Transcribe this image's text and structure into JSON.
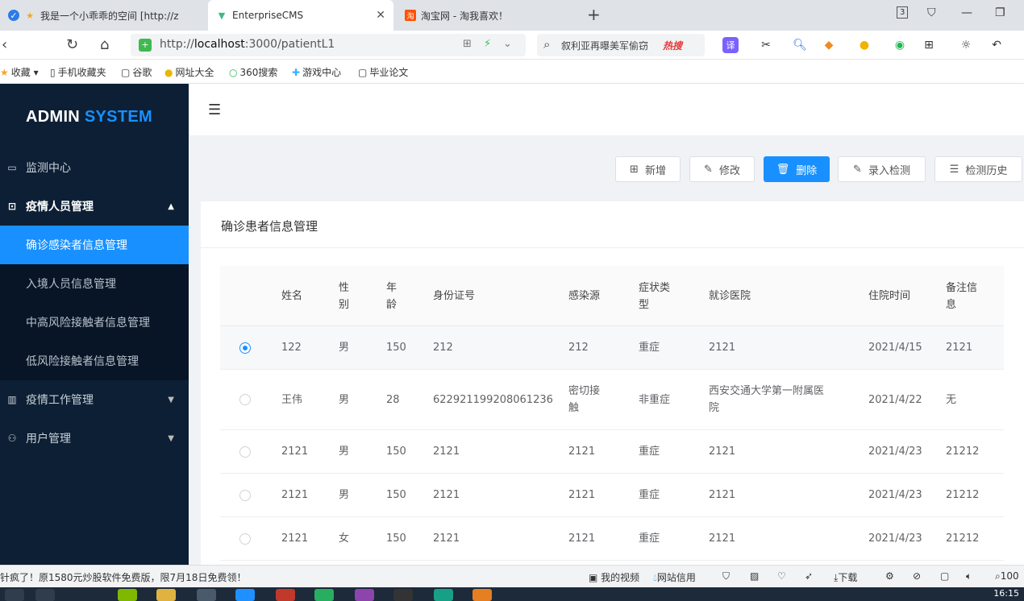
{
  "browser": {
    "tabs": [
      {
        "label": "我是一个小乖乖的空间 [http://z",
        "icon": "star-icon"
      },
      {
        "label": "EnterpriseCMS",
        "icon": "vue-logo-icon"
      },
      {
        "label": "淘宝网 - 淘我喜欢！",
        "icon": "taobao-icon"
      }
    ],
    "tab_count": "3",
    "url": {
      "prefix": "http://",
      "host": "localhost",
      "rest": ":3000/patientL1"
    },
    "search": {
      "text": "叙利亚再曝美军偷窃",
      "badge": "热搜"
    },
    "bookmarks": [
      "收藏",
      "手机收藏夹",
      "谷歌",
      "网址大全",
      "360搜索",
      "游戏中心",
      "毕业论文"
    ]
  },
  "app": {
    "logo": {
      "part1": "ADMIN ",
      "part2": "SYSTEM"
    },
    "menu": {
      "monitor": "监测中心",
      "epidemic_people": "疫情人员管理",
      "sub_confirmed": "确诊感染者信息管理",
      "sub_entry": "入境人员信息管理",
      "sub_high_risk": "中高风险接触者信息管理",
      "sub_low_risk": "低风险接触者信息管理",
      "epidemic_work": "疫情工作管理",
      "user_mgmt": "用户管理"
    },
    "toolbar": {
      "add": "新增",
      "edit": "修改",
      "delete": "删除",
      "record": "录入检测",
      "history": "检测历史"
    },
    "panel_title": "确诊患者信息管理",
    "table": {
      "headers": {
        "name": "姓名",
        "gender_1": "性",
        "gender_2": "别",
        "age_1": "年",
        "age_2": "龄",
        "id": "身份证号",
        "source": "感染源",
        "symptom_1": "症状类",
        "symptom_2": "型",
        "hospital": "就诊医院",
        "admit": "住院时间",
        "note_1": "备注信",
        "note_2": "息"
      },
      "rows": [
        {
          "name": "122",
          "gender": "男",
          "age": "150",
          "id": "212",
          "source": "212",
          "source2": "",
          "symptom": "重症",
          "hospital": "2121",
          "hospital2": "",
          "admit": "2021/4/15",
          "note": "2121"
        },
        {
          "name": "王伟",
          "gender": "男",
          "age": "28",
          "id": "622921199208061236",
          "source": "密切接",
          "source2": "触",
          "symptom": "非重症",
          "hospital": "西安交通大学第一附属医",
          "hospital2": "院",
          "admit": "2021/4/22",
          "note": "无"
        },
        {
          "name": "2121",
          "gender": "男",
          "age": "150",
          "id": "2121",
          "source": "2121",
          "source2": "",
          "symptom": "重症",
          "hospital": "2121",
          "hospital2": "",
          "admit": "2021/4/23",
          "note": "21212"
        },
        {
          "name": "2121",
          "gender": "男",
          "age": "150",
          "id": "2121",
          "source": "2121",
          "source2": "",
          "symptom": "重症",
          "hospital": "2121",
          "hospital2": "",
          "admit": "2021/4/23",
          "note": "21212"
        },
        {
          "name": "2121",
          "gender": "女",
          "age": "150",
          "id": "2121",
          "source": "2121",
          "source2": "",
          "symptom": "重症",
          "hospital": "2121",
          "hospital2": "",
          "admit": "2021/4/23",
          "note": "21212"
        }
      ]
    }
  },
  "statusbar": {
    "ad": "针疯了！原1580元炒股软件免费版，限7月18日免费领！",
    "video": "我的视频",
    "credit": "网站信用",
    "download": "下载",
    "zoom": "100"
  },
  "taskbar": {
    "clock": "16:15"
  },
  "colors": {
    "sidebar_bg": "#0d1f34",
    "accent": "#1890ff",
    "active_menu": "#1890ff"
  }
}
